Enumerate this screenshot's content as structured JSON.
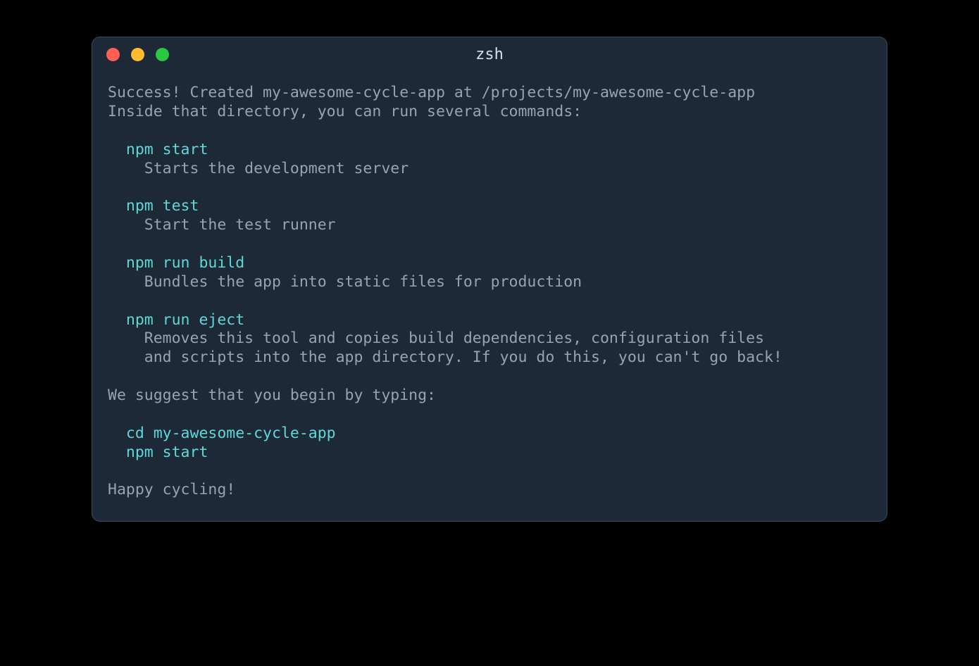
{
  "window": {
    "title": "zsh"
  },
  "colors": {
    "background": "#1e2937",
    "text": "#99a3b0",
    "cyan": "#5dd8d8",
    "red": "#ff5f57",
    "yellow": "#febc2e",
    "green": "#28c840"
  },
  "output": {
    "line1": "Success! Created my-awesome-cycle-app at /projects/my-awesome-cycle-app",
    "line2": "Inside that directory, you can run several commands:",
    "cmd1": "  npm start",
    "cmd1_desc": "    Starts the development server",
    "cmd2": "  npm test",
    "cmd2_desc": "    Start the test runner",
    "cmd3": "  npm run build",
    "cmd3_desc": "    Bundles the app into static files for production",
    "cmd4": "  npm run eject",
    "cmd4_desc1": "    Removes this tool and copies build dependencies, configuration files",
    "cmd4_desc2": "    and scripts into the app directory. If you do this, you can't go back!",
    "suggest": "We suggest that you begin by typing:",
    "suggest_cmd1": "  cd my-awesome-cycle-app",
    "suggest_cmd2": "  npm start",
    "closing": "Happy cycling!"
  }
}
